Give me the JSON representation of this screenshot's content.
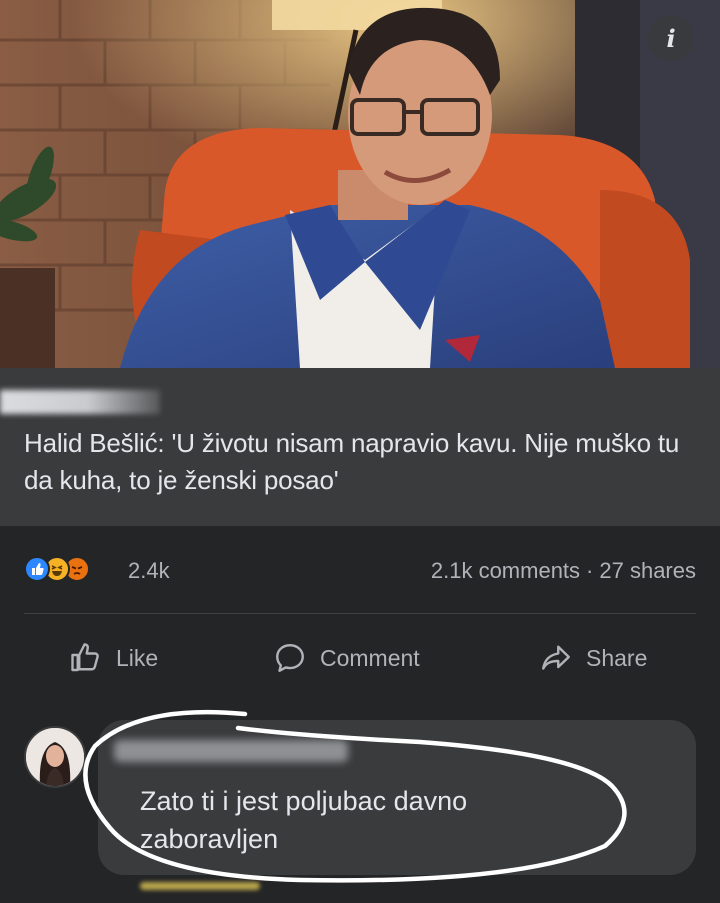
{
  "post": {
    "info_icon": "info-icon",
    "headline": "Halid Bešlić: 'U životu nisam napravio kavu. Nije muško tu da kuha, to je ženski posao'"
  },
  "stats": {
    "reaction_icons": [
      "like-reaction-icon",
      "haha-reaction-icon",
      "angry-reaction-icon"
    ],
    "reaction_count": "2.4k",
    "comments": "2.1k comments",
    "separator": "·",
    "shares": "27 shares"
  },
  "actions": {
    "like": "Like",
    "comment": "Comment",
    "share": "Share"
  },
  "comment": {
    "text": "Zato ti i jest poljubac davno zaboravljen"
  },
  "colors": {
    "background": "#18191a",
    "card": "#242526",
    "preview": "#3a3b3c",
    "text": "#e4e6eb",
    "muted": "#b0b3b8",
    "like_blue": "#2d88ff"
  }
}
